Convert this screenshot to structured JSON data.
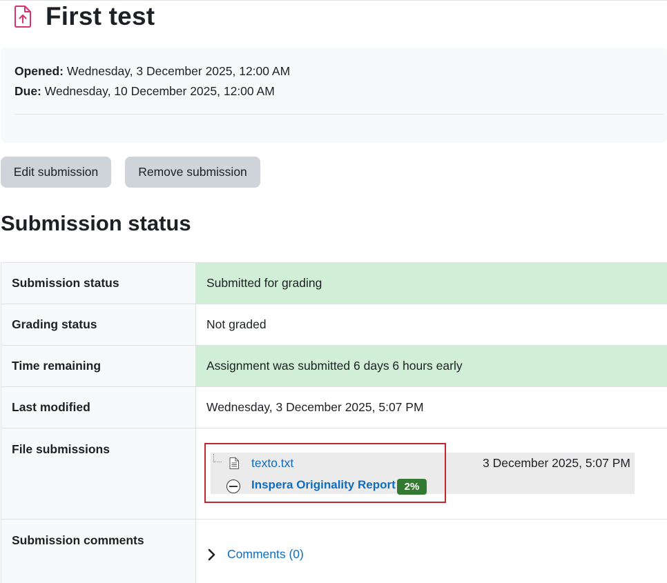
{
  "header": {
    "title": "First test",
    "icon": "assignment-upload-icon",
    "icon_color": "#d6336c"
  },
  "dates": {
    "opened_label": "Opened:",
    "opened_value": "Wednesday, 3 December 2025, 12:00 AM",
    "due_label": "Due:",
    "due_value": "Wednesday, 10 December 2025, 12:00 AM"
  },
  "actions": {
    "edit_label": "Edit submission",
    "remove_label": "Remove submission"
  },
  "section_title": "Submission status",
  "status_rows": [
    {
      "label": "Submission status",
      "value": "Submitted for grading",
      "highlight": "#d1eed6"
    },
    {
      "label": "Grading status",
      "value": "Not graded"
    },
    {
      "label": "Time remaining",
      "value": "Assignment was submitted 6 days 6 hours early",
      "highlight": "#d1eed6"
    },
    {
      "label": "Last modified",
      "value": "Wednesday, 3 December 2025, 5:07 PM"
    },
    {
      "label": "File submissions"
    },
    {
      "label": "Submission comments"
    }
  ],
  "file_submission": {
    "file_name": "texto.txt",
    "file_icon": "text-file-icon",
    "file_date": "3 December 2025, 5:07 PM",
    "report_logo": "inspera-logo-icon",
    "report_label": "Inspera Originality Report",
    "score": "2%",
    "score_color": "#357a32",
    "highlight_color": "#c0262b"
  },
  "comments": {
    "link_label": "Comments (0)",
    "icon": "chevron-right-icon"
  },
  "colors": {
    "link": "#0f6cbf",
    "button_bg": "#ced4da",
    "label_bg": "#f8f9fa"
  }
}
